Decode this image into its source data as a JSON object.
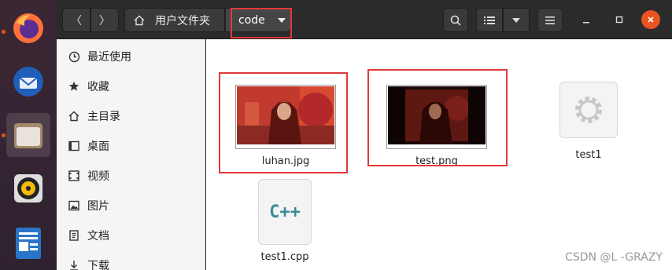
{
  "titlebar": {
    "back_glyph": "〈",
    "forward_glyph": "〉",
    "home_label": "用户文件夹",
    "current_folder": "code"
  },
  "sidebar": {
    "items": [
      {
        "label": "最近使用",
        "icon": "clock-icon"
      },
      {
        "label": "收藏",
        "icon": "star-icon"
      },
      {
        "label": "主目录",
        "icon": "home-icon"
      },
      {
        "label": "桌面",
        "icon": "desktop-icon"
      },
      {
        "label": "视频",
        "icon": "video-icon"
      },
      {
        "label": "图片",
        "icon": "picture-icon"
      },
      {
        "label": "文档",
        "icon": "document-icon"
      },
      {
        "label": "下载",
        "icon": "download-icon"
      }
    ]
  },
  "files": [
    {
      "name": "luhan.jpg",
      "type": "image"
    },
    {
      "name": "test.png",
      "type": "image"
    },
    {
      "name": "test1",
      "type": "executable"
    },
    {
      "name": "test1.cpp",
      "type": "cpp-source",
      "icon_text": "C++"
    }
  ],
  "watermark": "CSDN @L -GRAZY",
  "colors": {
    "accent": "#e95420",
    "highlight": "#e0393a"
  }
}
